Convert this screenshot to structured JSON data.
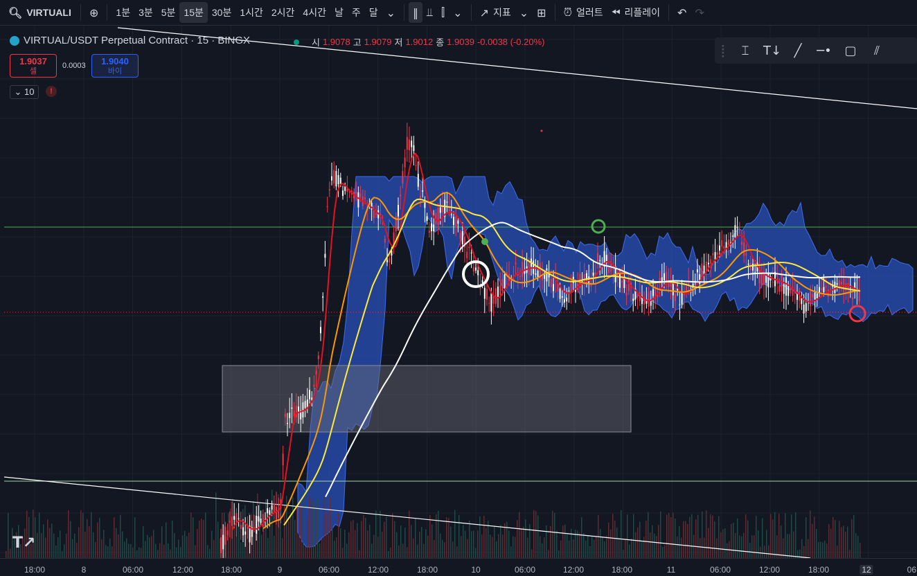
{
  "toolbar": {
    "symbol": "VIRTUALI",
    "intervals": [
      "1분",
      "3분",
      "5분",
      "15분",
      "30분",
      "1시간",
      "2시간",
      "4시간",
      "날",
      "주",
      "달"
    ],
    "active_interval": "15분",
    "indicators_label": "지표",
    "alert_label": "얼러트",
    "replay_label": "리플레이"
  },
  "legend": {
    "title": "VIRTUAL/USDT Perpetual Contract · 15 · BINGX",
    "open_label": "시",
    "open": "1.9078",
    "high_label": "고",
    "high": "1.9079",
    "low_label": "저",
    "low": "1.9012",
    "close_label": "종",
    "close": "1.9039",
    "change": "-0.0038 (-0.20%)"
  },
  "trade": {
    "sell_price": "1.9037",
    "sell_label": "셀",
    "buy_price": "1.9040",
    "buy_label": "바이",
    "spread": "0.0003",
    "quantity": "10",
    "warning": "!"
  },
  "xaxis": {
    "labels": [
      "18:00",
      "8",
      "06:00",
      "12:00",
      "18:00",
      "9",
      "06:00",
      "12:00",
      "18:00",
      "10",
      "06:00",
      "12:00",
      "18:00",
      "11",
      "06:00",
      "12:00",
      "18:00",
      "12",
      "06:"
    ],
    "active": "12"
  },
  "colors": {
    "background": "#131722",
    "up": "#ffffff",
    "down": "#f23645",
    "ema_fast": "#e5131f",
    "ema_mid": "#ff9800",
    "ema_slow": "#ffeb3b",
    "ema_long": "#ffffff",
    "cloud": "#2a50b8",
    "hline": "#4caf50"
  },
  "icons": [
    "search-icon",
    "add-symbol-icon",
    "chevron-down-icon",
    "candle-type-icon",
    "bar-type-icon",
    "indicators-icon",
    "layout-icon",
    "alert-icon",
    "replay-icon",
    "undo-icon",
    "redo-icon"
  ]
}
